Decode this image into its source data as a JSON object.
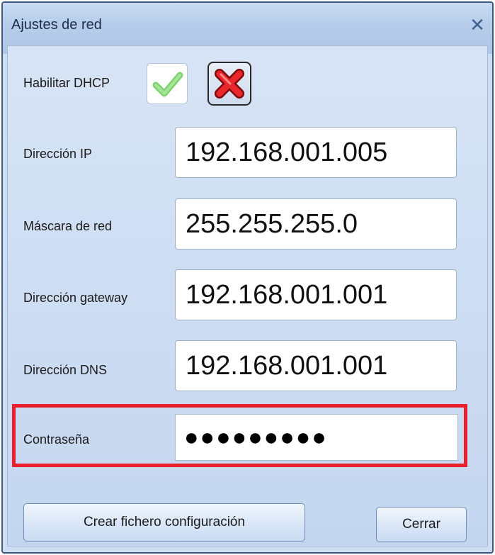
{
  "window": {
    "title": "Ajustes de red"
  },
  "dhcp": {
    "label": "Habilitar DHCP",
    "enable_icon": "checkmark-icon",
    "disable_icon": "red-x-icon"
  },
  "fields": {
    "ip": {
      "label": "Dirección IP",
      "value": "192.168.001.005"
    },
    "mask": {
      "label": "Máscara de red",
      "value": "255.255.255.0"
    },
    "gateway": {
      "label": "Dirección gateway",
      "value": "192.168.001.001"
    },
    "dns": {
      "label": "Dirección DNS",
      "value": "192.168.001.001"
    },
    "password": {
      "label": "Contraseña",
      "value": "●●●●●●●●●"
    }
  },
  "buttons": {
    "create_config": "Crear fichero configuración",
    "close": "Cerrar"
  },
  "colors": {
    "highlight": "#e8202b",
    "window_bg": "#cdddf2"
  }
}
